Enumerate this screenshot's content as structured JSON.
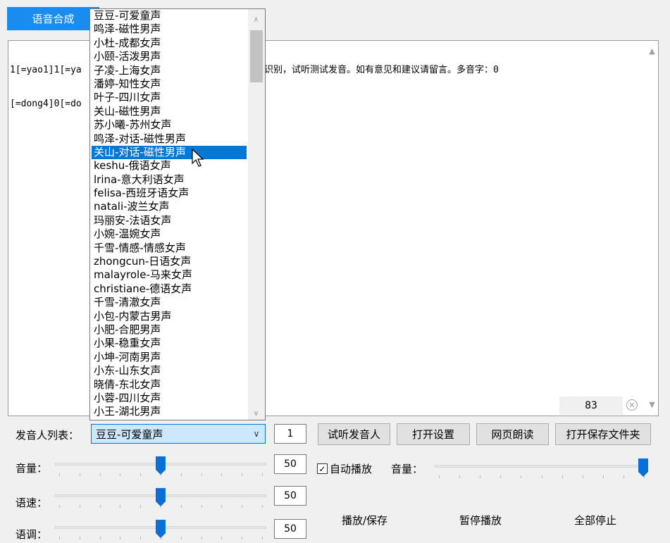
{
  "tab": {
    "label": "语音合成"
  },
  "editor": {
    "line1_left": "1[=yao1]1[=ya",
    "line1_right": "识别，试听测试发音。如有意见和建议请留言。多音字：0",
    "line2_left": "[=dong4]0[=do",
    "char_count": "83"
  },
  "dropdown": {
    "items": [
      "豆豆-可爱童声",
      "鸣泽-磁性男声",
      "小杜-成都女声",
      "小颐-活泼男声",
      "子凌-上海女声",
      "潘婷-知性女声",
      "叶子-四川女声",
      "关山-磁性男声",
      "苏小曦-苏州女声",
      "鸣泽-对话-磁性男声",
      "关山-对话-磁性男声",
      "keshu-俄语女声",
      "lrina-意大利语女声",
      "felisa-西班牙语女声",
      "natali-波兰女声",
      "玛丽安-法语女声",
      "小婉-温婉女声",
      "千雪-情感-情感女声",
      "zhongcun-日语女声",
      "malayrole-马来女声",
      "christiane-德语女声",
      "千雪-清澈女声",
      "小包-内蒙古男声",
      "小肥-合肥男声",
      "小果-稳重女声",
      "小坤-河南男声",
      "小东-山东女声",
      "晓倩-东北女声",
      "小蓉-四川女声",
      "小王-湖北男声"
    ],
    "selected_index": 10
  },
  "speaker": {
    "label": "发音人列表：",
    "selected": "豆豆-可爱童声",
    "count": "1"
  },
  "buttons": {
    "preview": "试听发音人",
    "settings": "打开设置",
    "web_read": "网页朗读",
    "open_folder": "打开保存文件夹"
  },
  "sliders": {
    "volume": {
      "label": "音量：",
      "value": "50",
      "level": 0.5
    },
    "speed": {
      "label": "语速：",
      "value": "50",
      "level": 0.5
    },
    "pitch": {
      "label": "语调：",
      "value": "50",
      "level": 0.5
    }
  },
  "playback": {
    "autoplay_label": "自动播放",
    "autoplay_checked": true,
    "volume_label": "音量：",
    "volume_level": 1.0,
    "play_save": "播放/保存",
    "pause": "暂停播放",
    "stop_all": "全部停止"
  },
  "colors": {
    "accent": "#1a8cf0",
    "selection": "#0078d7",
    "slider_thumb": "#0a6fd6"
  }
}
